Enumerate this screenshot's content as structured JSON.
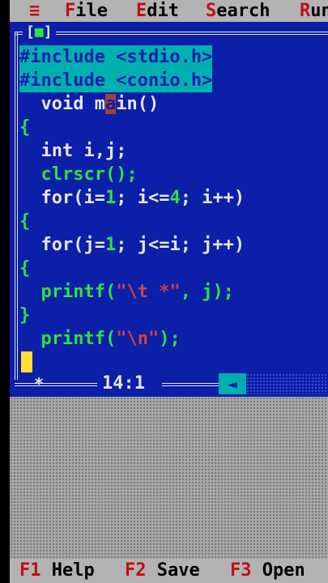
{
  "menu": {
    "system_glyph": "≡",
    "items": [
      {
        "hot": "F",
        "rest": "ile"
      },
      {
        "hot": "E",
        "rest": "dit"
      },
      {
        "hot": "S",
        "rest": "earch"
      },
      {
        "hot": "R",
        "rest": "un"
      }
    ]
  },
  "window": {
    "close_box": "[",
    "close_mark": "■",
    "close_end": "]"
  },
  "code": {
    "line1": "#include <stdio.h>",
    "line2": "#include <conio.h>",
    "line3_pre": "  void m",
    "line3_cur": "a",
    "line3_post": "in()",
    "line4": "{",
    "line5": "  int i,j;",
    "line6": "  clrscr();",
    "line7_a": "  for(i=",
    "line7_b": "1",
    "line7_c": "; i<=",
    "line7_d": "4",
    "line7_e": "; i++)",
    "line8": "{",
    "line9_a": "  for(j=",
    "line9_b": "1",
    "line9_c": "; j<=i; j++)",
    "line10": "{",
    "line11_a": "  printf(",
    "line11_b": "\"\\t *\"",
    "line11_c": ", j);",
    "line12": "}",
    "line13_a": "  printf(",
    "line13_b": "\"\\n\"",
    "line13_c": ");"
  },
  "status": {
    "modified": "*",
    "position": "14:1",
    "scroll_left_arrow": "◄"
  },
  "hints": [
    {
      "key": "F1",
      "label": "Help"
    },
    {
      "key": "F2",
      "label": "Save"
    },
    {
      "key": "F3",
      "label": "Open"
    }
  ],
  "colors": {
    "editor_bg": "#0c1fa8",
    "menu_bg": "#b3b3b3",
    "hotkey": "#c01010",
    "selection": "#00b0b0",
    "cursor": "#ffdd33"
  }
}
